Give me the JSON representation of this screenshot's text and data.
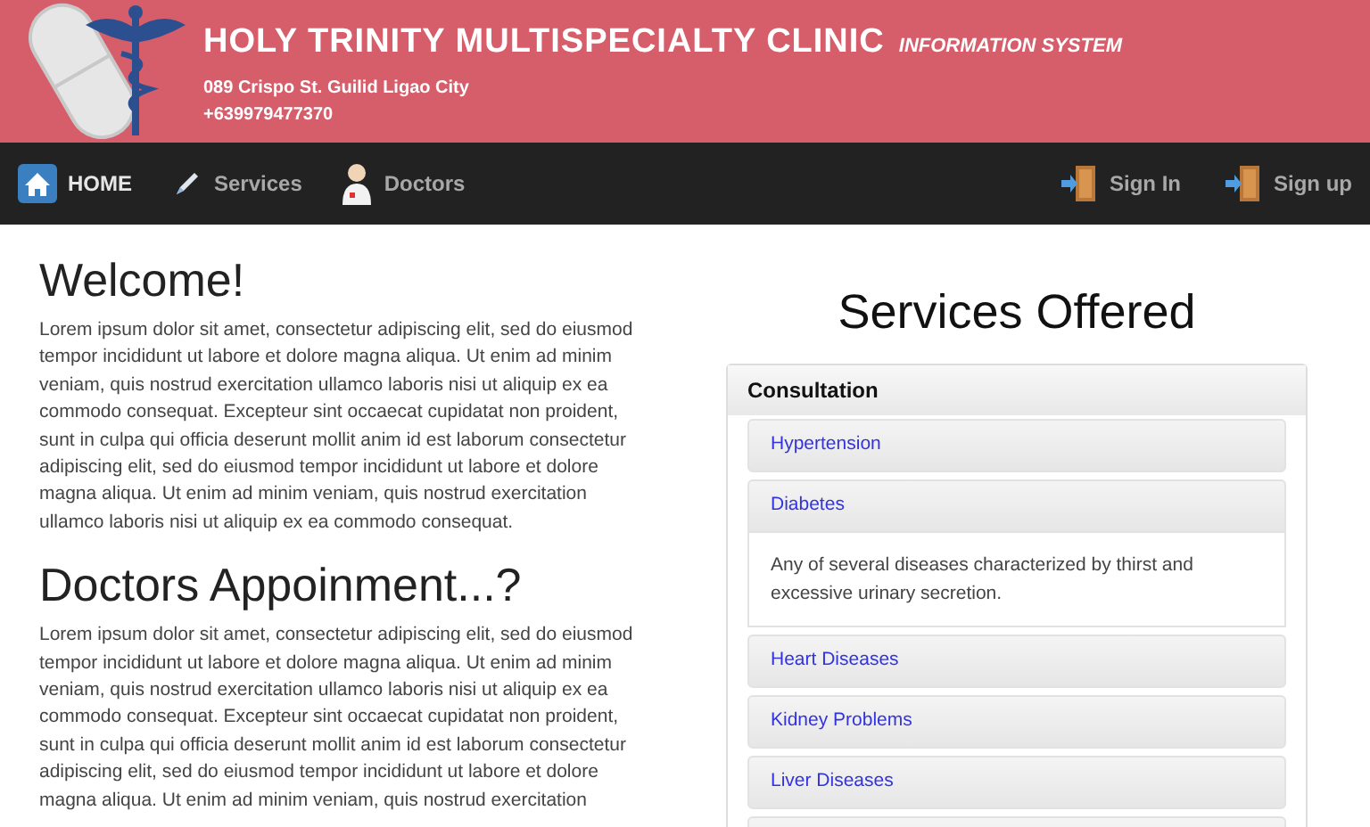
{
  "header": {
    "title": "HOLY TRINITY MULTISPECIALTY CLINIC",
    "subtitle": "INFORMATION SYSTEM",
    "address": "089 Crispo St. Guilid Ligao City",
    "phone": "+639979477370"
  },
  "nav": {
    "left": [
      {
        "label": "HOME",
        "kind": "home",
        "selected": true
      },
      {
        "label": "Services",
        "kind": "pen",
        "selected": false
      },
      {
        "label": "Doctors",
        "kind": "doctor",
        "selected": false
      }
    ],
    "right": [
      {
        "label": "Sign In",
        "kind": "door"
      },
      {
        "label": "Sign up",
        "kind": "door"
      }
    ]
  },
  "sections": [
    {
      "heading": "Welcome!",
      "text": "Lorem ipsum dolor sit amet, consectetur adipiscing elit, sed do eiusmod tempor incididunt ut labore et dolore magna aliqua. Ut enim ad minim veniam, quis nostrud exercitation ullamco laboris nisi ut aliquip ex ea commodo consequat. Excepteur sint occaecat cupidatat non proident, sunt in culpa qui officia deserunt mollit anim id est laborum consectetur adipiscing elit, sed do eiusmod tempor incididunt ut labore et dolore magna aliqua. Ut enim ad minim veniam, quis nostrud exercitation ullamco laboris nisi ut aliquip ex ea commodo consequat."
    },
    {
      "heading": "Doctors Appoinment...?",
      "text": "Lorem ipsum dolor sit amet, consectetur adipiscing elit, sed do eiusmod tempor incididunt ut labore et dolore magna aliqua. Ut enim ad minim veniam, quis nostrud exercitation ullamco laboris nisi ut aliquip ex ea commodo consequat. Excepteur sint occaecat cupidatat non proident, sunt in culpa qui officia deserunt mollit anim id est laborum consectetur adipiscing elit, sed do eiusmod tempor incididunt ut labore et dolore magna aliqua. Ut enim ad minim veniam, quis nostrud exercitation"
    }
  ],
  "services": {
    "title": "Services Offered",
    "group": "Consultation",
    "items": [
      {
        "label": "Hypertension",
        "expanded": false
      },
      {
        "label": "Diabetes",
        "expanded": true,
        "description": "Any of several diseases characterized by thirst and excessive urinary secretion."
      },
      {
        "label": "Heart Diseases",
        "expanded": false
      },
      {
        "label": "Kidney Problems",
        "expanded": false
      },
      {
        "label": "Liver Diseases",
        "expanded": false
      }
    ]
  }
}
